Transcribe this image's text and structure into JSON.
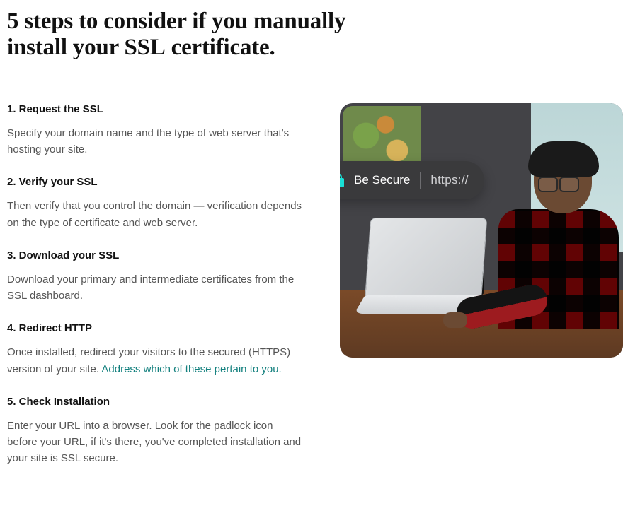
{
  "title": "5 steps to consider if you manually install your SSL certificate.",
  "steps": [
    {
      "heading": "1. Request the SSL",
      "body": "Specify your domain name and the type of web server that's hosting your site."
    },
    {
      "heading": "2. Verify your SSL",
      "body": "Then verify that you control the domain — verification depends on the type of certificate and web server."
    },
    {
      "heading": "3. Download your SSL",
      "body": "Download your primary and intermediate certificates from the SSL dashboard."
    },
    {
      "heading": "4. Redirect HTTP",
      "body_prefix": "Once installed, redirect your visitors to the secured (HTTPS) version of your site. ",
      "link_text": "Address which of these pertain to you."
    },
    {
      "heading": "5. Check Installation",
      "body": "Enter your URL into a browser. Look for the padlock icon before your URL, if it's there, you've completed installation and your site is SSL secure."
    }
  ],
  "pill": {
    "label": "Be Secure",
    "protocol": "https://"
  }
}
